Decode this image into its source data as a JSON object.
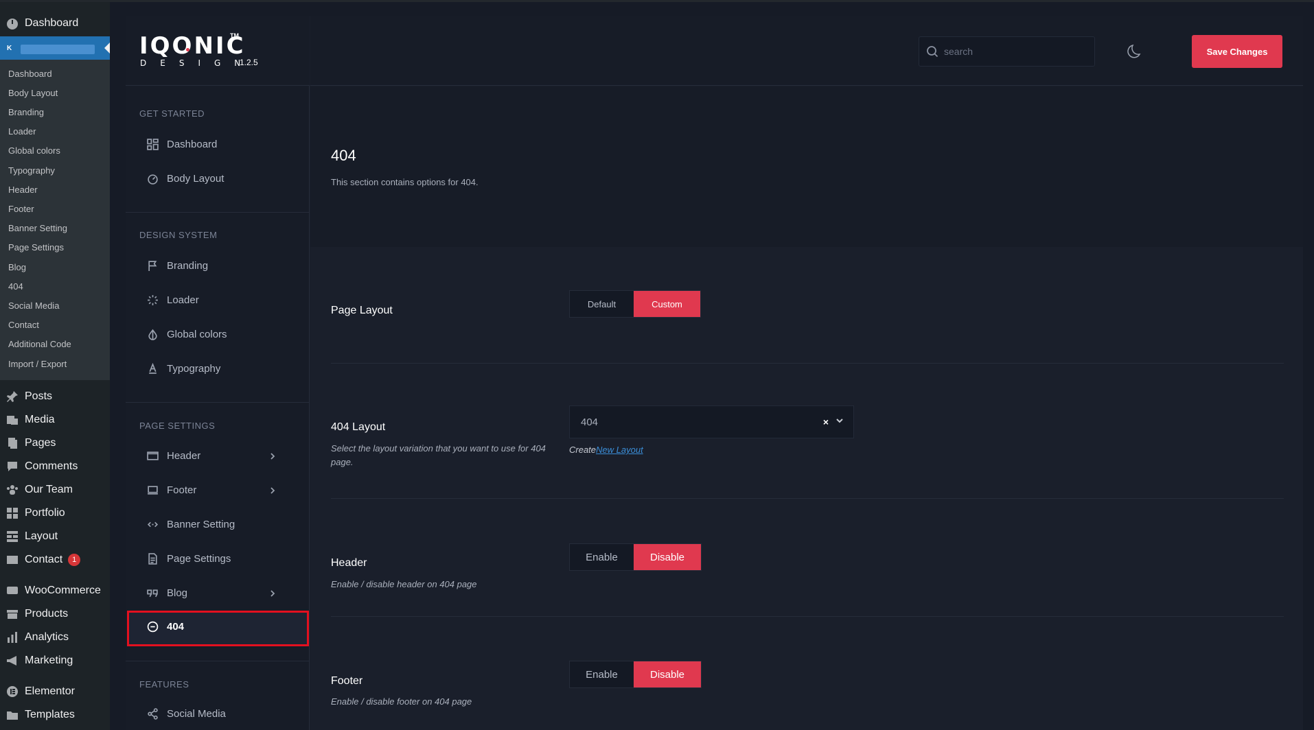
{
  "wp_sidebar": {
    "top_item": "Dashboard",
    "current_badge": "K",
    "submenu": [
      "Dashboard",
      "Body Layout",
      "Branding",
      "Loader",
      "Global colors",
      "Typography",
      "Header",
      "Footer",
      "Banner Setting",
      "Page Settings",
      "Blog",
      "404",
      "Social Media",
      "Contact",
      "Additional Code",
      "Import / Export"
    ],
    "menu": [
      {
        "label": "Posts",
        "icon": "pin-icon"
      },
      {
        "label": "Media",
        "icon": "media-icon"
      },
      {
        "label": "Pages",
        "icon": "pages-icon"
      },
      {
        "label": "Comments",
        "icon": "comments-icon"
      },
      {
        "label": "Our Team",
        "icon": "team-icon"
      },
      {
        "label": "Portfolio",
        "icon": "portfolio-icon"
      },
      {
        "label": "Layout",
        "icon": "layout-icon"
      },
      {
        "label": "Contact",
        "icon": "mail-icon",
        "badge": "1"
      },
      {
        "label": "WooCommerce",
        "icon": "woo-icon"
      },
      {
        "label": "Products",
        "icon": "products-icon"
      },
      {
        "label": "Analytics",
        "icon": "analytics-icon"
      },
      {
        "label": "Marketing",
        "icon": "megaphone-icon"
      },
      {
        "label": "Elementor",
        "icon": "elementor-icon"
      },
      {
        "label": "Templates",
        "icon": "folder-icon"
      }
    ]
  },
  "brand": {
    "logo_text": "IQONIC",
    "logo_tm": "TM",
    "logo_sub": "DESIGN",
    "version": "1.2.5"
  },
  "nav": {
    "sections": {
      "get_started": "GET STARTED",
      "design_system": "DESIGN SYSTEM",
      "page_settings": "PAGE SETTINGS",
      "features": "FEATURES"
    },
    "items": {
      "dashboard": "Dashboard",
      "body_layout": "Body Layout",
      "branding": "Branding",
      "loader": "Loader",
      "global_colors": "Global colors",
      "typography": "Typography",
      "header": "Header",
      "footer": "Footer",
      "banner_setting": "Banner Setting",
      "page_settings": "Page Settings",
      "blog": "Blog",
      "notfound": "404",
      "social_media": "Social Media"
    }
  },
  "header": {
    "search_placeholder": "search",
    "save_label": "Save Changes"
  },
  "content": {
    "title": "404",
    "description": "This section contains options for 404.",
    "page_layout": {
      "label": "Page Layout",
      "options": [
        "Default",
        "Custom"
      ],
      "selected": "Custom"
    },
    "layout_404": {
      "label": "404 Layout",
      "help": "Select the layout variation that you want to use for 404 page.",
      "value": "404",
      "clear": "×",
      "create_prefix": "Create",
      "create_link": "New Layout"
    },
    "header_setting": {
      "label": "Header",
      "help": "Enable / disable header on 404 page",
      "options": [
        "Enable",
        "Disable"
      ],
      "selected": "Disable"
    },
    "footer_setting": {
      "label": "Footer",
      "help": "Enable / disable footer on 404 page",
      "options": [
        "Enable",
        "Disable"
      ],
      "selected": "Disable"
    }
  },
  "colors": {
    "accent": "#e0394f",
    "wp_blue": "#2271b1",
    "active_outline": "#e3101f"
  }
}
